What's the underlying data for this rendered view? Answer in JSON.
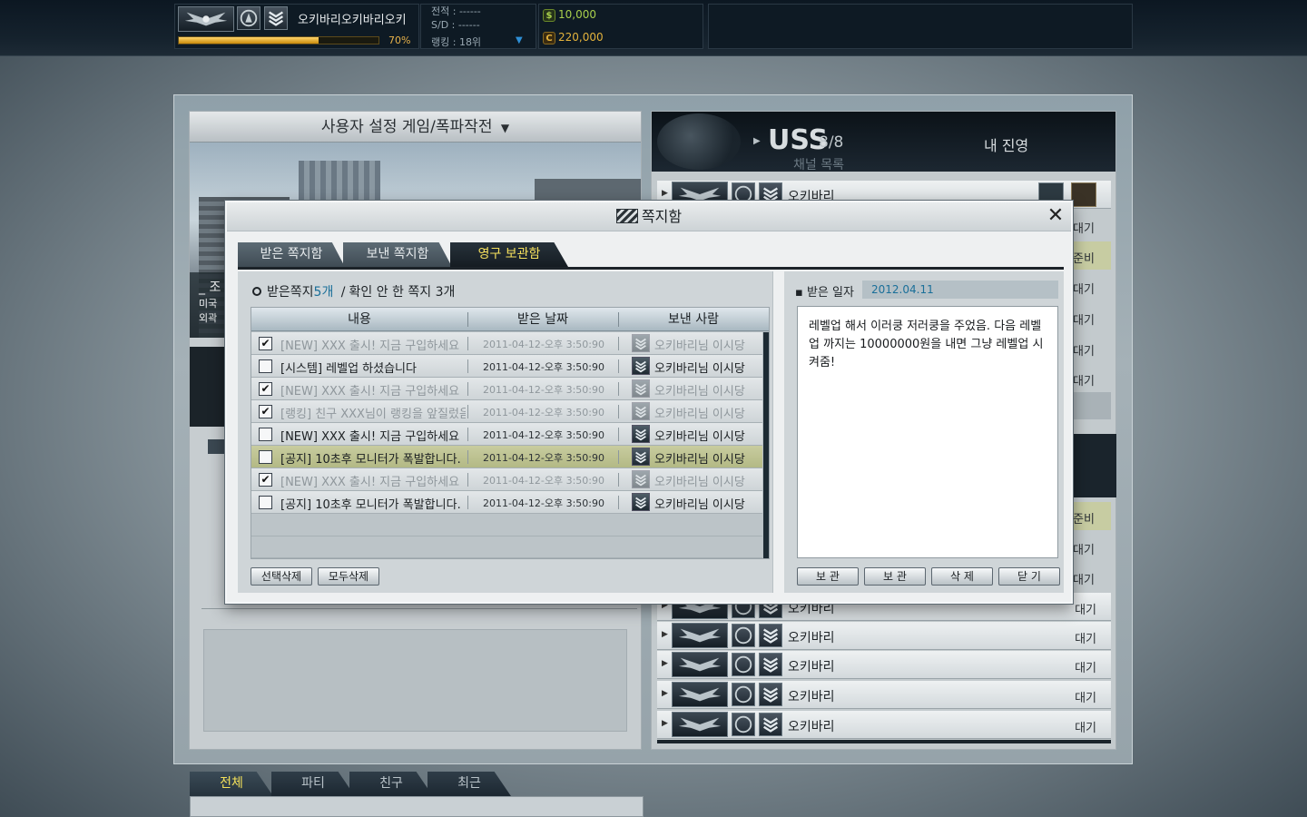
{
  "topbar": {
    "player_name": "오키바리오키바리오키",
    "xp_percent_text": "70%",
    "xp_fraction": 0.7,
    "record_label": "전적 : ------",
    "sd_label": "S/D : ------",
    "ranking_label": "랭킹 : 18위",
    "dollar_icon": "$",
    "dollar_amount": "10,000",
    "cash_icon": "C",
    "cash_amount": "220,000"
  },
  "left": {
    "mode_title": "사용자 설정 게임/폭파작전",
    "mode_dropdown_icon": "▼",
    "side_label_1": "_ 조",
    "side_label_2": "미국",
    "side_label_3": "외곽"
  },
  "right": {
    "team_name": "USS",
    "team_count": "8/8",
    "my_team_label": "내 진영",
    "channel_ghost": "채널 목록",
    "players": [
      {
        "name": "오키바리",
        "status": ""
      },
      {
        "name": "오키바리",
        "status": "대기"
      },
      {
        "name": "오키바리",
        "status": "대기"
      },
      {
        "name": "오키바리",
        "status": "대기"
      },
      {
        "name": "오키바리",
        "status": "대기"
      },
      {
        "name": "오키바리",
        "status": "대기"
      }
    ],
    "side_statuses": [
      "대기",
      "준비",
      "대기",
      "대기",
      "대기",
      "대기",
      "준비",
      "대기",
      "대기"
    ]
  },
  "chat": {
    "tabs": [
      "전체",
      "파티",
      "친구",
      "최근"
    ]
  },
  "dialog": {
    "title": "쪽지함",
    "close_icon": "✕",
    "tabs": [
      "받은 쪽지함",
      "보낸 쪽지함",
      "영구 보관함"
    ],
    "summary_label": "받은쪽지",
    "summary_count": "5개",
    "summary_sep": "/",
    "summary_unread": "확인 안 한 쪽지 3개",
    "columns": [
      "내용",
      "받은 날짜",
      "보낸 사람"
    ],
    "messages": [
      {
        "checked": "✔",
        "content": "[NEW] XXX 출시! 지금 구입하세요",
        "date": "2011-04-12-오후 3:50:90",
        "sender": "오키바리님 이시당"
      },
      {
        "checked": "",
        "content": " [시스템] 레벨업 하셨습니다",
        "date": "2011-04-12-오후 3:50:90",
        "sender": "오키바리님 이시당"
      },
      {
        "checked": "✔",
        "content": "[NEW] XXX 출시! 지금 구입하세요",
        "date": "2011-04-12-오후 3:50:90",
        "sender": "오키바리님 이시당"
      },
      {
        "checked": "✔",
        "content": "[랭킹] 친구 XXX님이 랭킹을 앞질렀음.",
        "date": "2011-04-12-오후 3:50:90",
        "sender": "오키바리님 이시당"
      },
      {
        "checked": "",
        "content": "[NEW] XXX 출시! 지금 구입하세요",
        "date": "2011-04-12-오후 3:50:90",
        "sender": "오키바리님 이시당"
      },
      {
        "checked": "",
        "content": "[공지] 10초후 모니터가 폭발합니다.",
        "date": "2011-04-12-오후 3:50:90",
        "sender": "오키바리님 이시당"
      },
      {
        "checked": "✔",
        "content": "[NEW] XXX 출시! 지금 구입하세요",
        "date": "2011-04-12-오후 3:50:90",
        "sender": "오키바리님 이시당"
      },
      {
        "checked": "",
        "content": "[공지] 10초후 모니터가 폭발합니다.",
        "date": "2011-04-12-오후 3:50:90",
        "sender": "오키바리님 이시당"
      }
    ],
    "delete_selected_label": "선택삭제",
    "delete_all_label": "모두삭제",
    "received_date_label": "받은 일자",
    "received_date_value": "2012.04.11",
    "message_body": "레벨업 해서 이러쿵 저러쿵을 주었음. 다음 레벨업 까지는 10000000원을 내면 그냥 레벨업 시켜줌!",
    "reader_buttons": [
      "보 관",
      "보 관",
      "삭 제",
      "닫 기"
    ]
  },
  "colors": {
    "accent_yellow": "#f5e05d",
    "count_blue": "#1a6f99",
    "selected_row": "#c8cc9f"
  }
}
